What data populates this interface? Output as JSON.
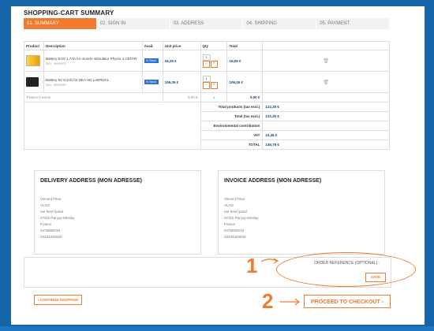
{
  "page_title": "SHOPPING-CART SUMMARY",
  "steps": [
    {
      "label": "01. SUMMARY"
    },
    {
      "label": "02. SIGN IN"
    },
    {
      "label": "03. ADDRESS"
    },
    {
      "label": "04. SHIPPING"
    },
    {
      "label": "05. PAYMENT"
    }
  ],
  "table_headers": {
    "product": "Product",
    "description": "Description",
    "avail": "Avail.",
    "unit_price": "Unit price",
    "qty": "Qty",
    "total": "Total"
  },
  "products": [
    {
      "name": "Battery 9.6V 1.7Ah for muscle stimulator Physio 4 CEFAR",
      "sku": "SKU : 99999070",
      "availability": "In Stock",
      "unit_price": "16,25 €",
      "qty": "1",
      "total": "16,25 €"
    },
    {
      "name": "Battery 9V 8.2Ah for DEA HD LAERDAL",
      "sku": "SKU : 99999050",
      "availability": "In Stock",
      "unit_price": "106,05 €",
      "qty": "1",
      "total": "106,05 €"
    }
  ],
  "shipping_row": {
    "label": "Franco 0 euros",
    "price": "0,00 €",
    "qty": "1",
    "total": "0,00 €"
  },
  "summary": [
    {
      "label": "Total products (tax excl.)",
      "value": "122,30 €"
    },
    {
      "label": "Total (tax excl.)",
      "value": "122,30 €"
    },
    {
      "label": "Environmental contribution",
      "value": ""
    },
    {
      "label": "VAT",
      "value": "24,45 €"
    },
    {
      "label": "TOTAL",
      "value": "146,75 €"
    }
  ],
  "delivery": {
    "title": "DELIVERY ADDRESS (MON ADRESSE)",
    "lines": [
      "Vincent Piton",
      "VLAD",
      "rue henri potal",
      "37210 Parçay-Meslay",
      "France",
      "0475865019",
      "33234325625"
    ]
  },
  "invoice": {
    "title": "INVOICE ADDRESS (MON ADRESSE)",
    "lines": [
      "Vincent Piton",
      "VLAD",
      "rue henri potal",
      "37210 Parçay-Meslay",
      "France",
      "0475865019",
      "33234325625"
    ]
  },
  "order_reference": {
    "label": "ORDER REFERENCE (OPTIONAL) :",
    "save": "SAVE"
  },
  "annotations": {
    "one": "1",
    "two": "2"
  },
  "buttons": {
    "continue": "‹ CONTINUE SHOPPING",
    "checkout": "PROCEED TO CHECKOUT ›"
  },
  "colors": {
    "accent": "#f07a2d",
    "frame": "#1565a8",
    "price": "#1b3a8a",
    "stock_badge": "#2a74d8"
  },
  "icons": {
    "trash": "trash-icon",
    "arrow": "arrow-right-icon"
  }
}
